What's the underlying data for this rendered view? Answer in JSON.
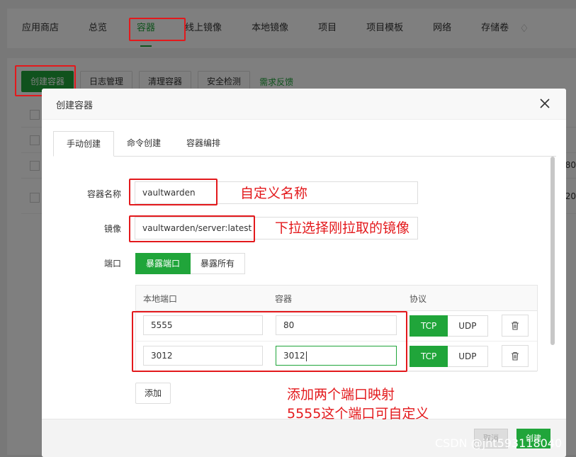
{
  "nav": {
    "items": [
      "应用商店",
      "总览",
      "容器",
      "线上镜像",
      "本地镜像",
      "项目",
      "项目模板",
      "网络",
      "存储卷"
    ],
    "active_index": 2
  },
  "toolbar": {
    "create_container": "创建容器",
    "log_management": "日志管理",
    "clean_containers": "清理容器",
    "security_check": "安全检测",
    "feedback": "需求反馈"
  },
  "background_table": {
    "cell_1": "80",
    "cell_2": "20"
  },
  "modal": {
    "title": "创建容器",
    "tabs": [
      "手动创建",
      "命令创建",
      "容器编排"
    ],
    "active_tab": 0,
    "fields": {
      "name_label": "容器名称",
      "name_value": "vaultwarden",
      "image_label": "镜像",
      "image_value": "vaultwarden/server:latest",
      "port_label": "端口"
    },
    "port_mode": {
      "expose_port": "暴露端口",
      "expose_all": "暴露所有",
      "selected": "暴露端口"
    },
    "port_table": {
      "headers": [
        "本地端口",
        "容器",
        "协议"
      ],
      "rows": [
        {
          "local": "5555",
          "container": "80",
          "protocol": "TCP"
        },
        {
          "local": "3012",
          "container": "3012",
          "protocol": "TCP"
        }
      ],
      "protocol_options": [
        "TCP",
        "UDP"
      ]
    },
    "add_button": "添加",
    "cancel_button": "取消",
    "create_button": "创建"
  },
  "annotations": {
    "name_note": "自定义名称",
    "image_note": "下拉选择刚拉取的镜像",
    "port_note_line1": "添加两个端口映射",
    "port_note_line2": "5555这个端口可自定义"
  },
  "watermark": "CSDN @jht593118040",
  "colors": {
    "accent": "#20a53a",
    "annotation": "#e3191c"
  }
}
